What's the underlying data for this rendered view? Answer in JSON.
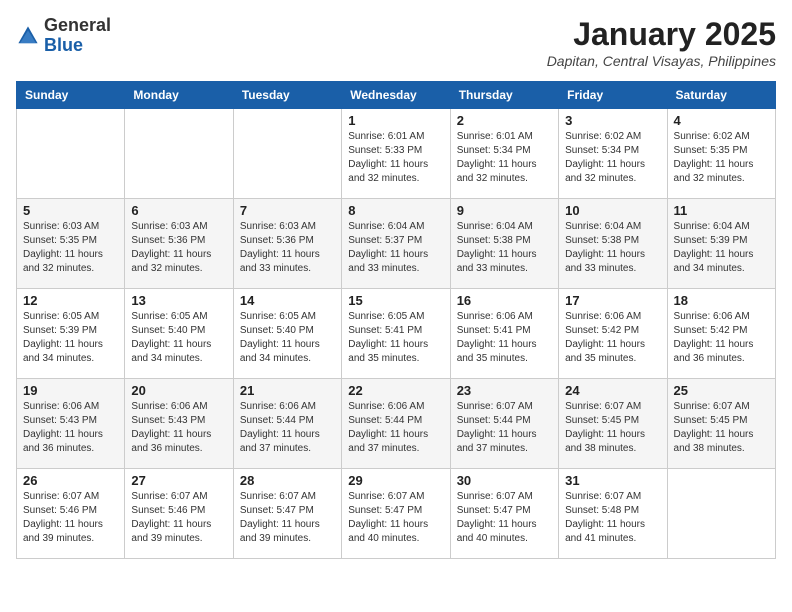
{
  "header": {
    "logo_general": "General",
    "logo_blue": "Blue",
    "month": "January 2025",
    "location": "Dapitan, Central Visayas, Philippines"
  },
  "days_of_week": [
    "Sunday",
    "Monday",
    "Tuesday",
    "Wednesday",
    "Thursday",
    "Friday",
    "Saturday"
  ],
  "weeks": [
    [
      {
        "day": "",
        "sunrise": "",
        "sunset": "",
        "daylight": ""
      },
      {
        "day": "",
        "sunrise": "",
        "sunset": "",
        "daylight": ""
      },
      {
        "day": "",
        "sunrise": "",
        "sunset": "",
        "daylight": ""
      },
      {
        "day": "1",
        "sunrise": "Sunrise: 6:01 AM",
        "sunset": "Sunset: 5:33 PM",
        "daylight": "Daylight: 11 hours and 32 minutes."
      },
      {
        "day": "2",
        "sunrise": "Sunrise: 6:01 AM",
        "sunset": "Sunset: 5:34 PM",
        "daylight": "Daylight: 11 hours and 32 minutes."
      },
      {
        "day": "3",
        "sunrise": "Sunrise: 6:02 AM",
        "sunset": "Sunset: 5:34 PM",
        "daylight": "Daylight: 11 hours and 32 minutes."
      },
      {
        "day": "4",
        "sunrise": "Sunrise: 6:02 AM",
        "sunset": "Sunset: 5:35 PM",
        "daylight": "Daylight: 11 hours and 32 minutes."
      }
    ],
    [
      {
        "day": "5",
        "sunrise": "Sunrise: 6:03 AM",
        "sunset": "Sunset: 5:35 PM",
        "daylight": "Daylight: 11 hours and 32 minutes."
      },
      {
        "day": "6",
        "sunrise": "Sunrise: 6:03 AM",
        "sunset": "Sunset: 5:36 PM",
        "daylight": "Daylight: 11 hours and 32 minutes."
      },
      {
        "day": "7",
        "sunrise": "Sunrise: 6:03 AM",
        "sunset": "Sunset: 5:36 PM",
        "daylight": "Daylight: 11 hours and 33 minutes."
      },
      {
        "day": "8",
        "sunrise": "Sunrise: 6:04 AM",
        "sunset": "Sunset: 5:37 PM",
        "daylight": "Daylight: 11 hours and 33 minutes."
      },
      {
        "day": "9",
        "sunrise": "Sunrise: 6:04 AM",
        "sunset": "Sunset: 5:38 PM",
        "daylight": "Daylight: 11 hours and 33 minutes."
      },
      {
        "day": "10",
        "sunrise": "Sunrise: 6:04 AM",
        "sunset": "Sunset: 5:38 PM",
        "daylight": "Daylight: 11 hours and 33 minutes."
      },
      {
        "day": "11",
        "sunrise": "Sunrise: 6:04 AM",
        "sunset": "Sunset: 5:39 PM",
        "daylight": "Daylight: 11 hours and 34 minutes."
      }
    ],
    [
      {
        "day": "12",
        "sunrise": "Sunrise: 6:05 AM",
        "sunset": "Sunset: 5:39 PM",
        "daylight": "Daylight: 11 hours and 34 minutes."
      },
      {
        "day": "13",
        "sunrise": "Sunrise: 6:05 AM",
        "sunset": "Sunset: 5:40 PM",
        "daylight": "Daylight: 11 hours and 34 minutes."
      },
      {
        "day": "14",
        "sunrise": "Sunrise: 6:05 AM",
        "sunset": "Sunset: 5:40 PM",
        "daylight": "Daylight: 11 hours and 34 minutes."
      },
      {
        "day": "15",
        "sunrise": "Sunrise: 6:05 AM",
        "sunset": "Sunset: 5:41 PM",
        "daylight": "Daylight: 11 hours and 35 minutes."
      },
      {
        "day": "16",
        "sunrise": "Sunrise: 6:06 AM",
        "sunset": "Sunset: 5:41 PM",
        "daylight": "Daylight: 11 hours and 35 minutes."
      },
      {
        "day": "17",
        "sunrise": "Sunrise: 6:06 AM",
        "sunset": "Sunset: 5:42 PM",
        "daylight": "Daylight: 11 hours and 35 minutes."
      },
      {
        "day": "18",
        "sunrise": "Sunrise: 6:06 AM",
        "sunset": "Sunset: 5:42 PM",
        "daylight": "Daylight: 11 hours and 36 minutes."
      }
    ],
    [
      {
        "day": "19",
        "sunrise": "Sunrise: 6:06 AM",
        "sunset": "Sunset: 5:43 PM",
        "daylight": "Daylight: 11 hours and 36 minutes."
      },
      {
        "day": "20",
        "sunrise": "Sunrise: 6:06 AM",
        "sunset": "Sunset: 5:43 PM",
        "daylight": "Daylight: 11 hours and 36 minutes."
      },
      {
        "day": "21",
        "sunrise": "Sunrise: 6:06 AM",
        "sunset": "Sunset: 5:44 PM",
        "daylight": "Daylight: 11 hours and 37 minutes."
      },
      {
        "day": "22",
        "sunrise": "Sunrise: 6:06 AM",
        "sunset": "Sunset: 5:44 PM",
        "daylight": "Daylight: 11 hours and 37 minutes."
      },
      {
        "day": "23",
        "sunrise": "Sunrise: 6:07 AM",
        "sunset": "Sunset: 5:44 PM",
        "daylight": "Daylight: 11 hours and 37 minutes."
      },
      {
        "day": "24",
        "sunrise": "Sunrise: 6:07 AM",
        "sunset": "Sunset: 5:45 PM",
        "daylight": "Daylight: 11 hours and 38 minutes."
      },
      {
        "day": "25",
        "sunrise": "Sunrise: 6:07 AM",
        "sunset": "Sunset: 5:45 PM",
        "daylight": "Daylight: 11 hours and 38 minutes."
      }
    ],
    [
      {
        "day": "26",
        "sunrise": "Sunrise: 6:07 AM",
        "sunset": "Sunset: 5:46 PM",
        "daylight": "Daylight: 11 hours and 39 minutes."
      },
      {
        "day": "27",
        "sunrise": "Sunrise: 6:07 AM",
        "sunset": "Sunset: 5:46 PM",
        "daylight": "Daylight: 11 hours and 39 minutes."
      },
      {
        "day": "28",
        "sunrise": "Sunrise: 6:07 AM",
        "sunset": "Sunset: 5:47 PM",
        "daylight": "Daylight: 11 hours and 39 minutes."
      },
      {
        "day": "29",
        "sunrise": "Sunrise: 6:07 AM",
        "sunset": "Sunset: 5:47 PM",
        "daylight": "Daylight: 11 hours and 40 minutes."
      },
      {
        "day": "30",
        "sunrise": "Sunrise: 6:07 AM",
        "sunset": "Sunset: 5:47 PM",
        "daylight": "Daylight: 11 hours and 40 minutes."
      },
      {
        "day": "31",
        "sunrise": "Sunrise: 6:07 AM",
        "sunset": "Sunset: 5:48 PM",
        "daylight": "Daylight: 11 hours and 41 minutes."
      },
      {
        "day": "",
        "sunrise": "",
        "sunset": "",
        "daylight": ""
      }
    ]
  ]
}
